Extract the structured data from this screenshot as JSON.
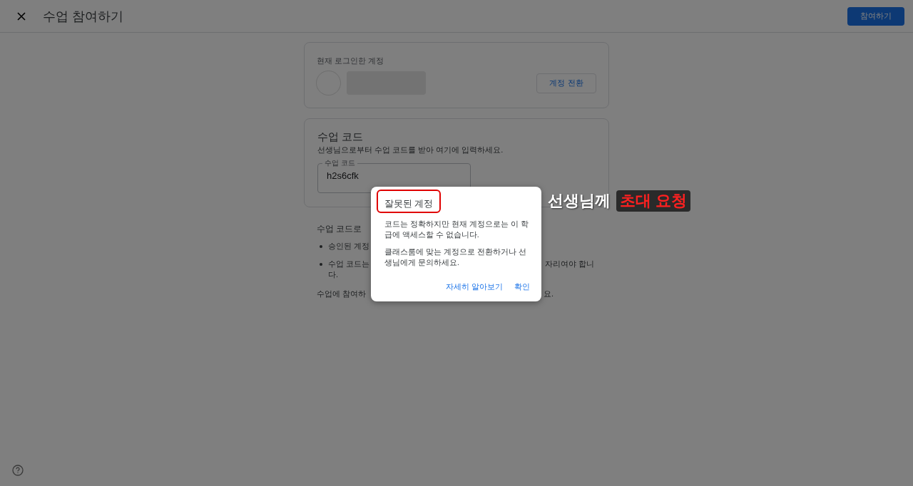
{
  "header": {
    "title": "수업 참여하기",
    "join_button": "참여하기"
  },
  "account_card": {
    "heading": "현재 로그인한 계정",
    "switch_button": "계정 전환"
  },
  "class_code_card": {
    "heading": "수업 코드",
    "description": "선생님으로부터 수업 코드를 받아 여기에 입력하세요.",
    "field": {
      "label": "수업 코드",
      "value": "h2s6cfk"
    }
  },
  "info": {
    "heading": "수업 코드로",
    "bullets": [
      {
        "lines": [
          {
            "left": "승인된 계정"
          }
        ]
      },
      {
        "lines": [
          {
            "left": "수업 코드는",
            "right": "자리여야 합니"
          },
          {
            "left": "다."
          }
        ]
      }
    ],
    "footer": {
      "left": "수업에 참여하",
      "right": "요."
    }
  },
  "dialog": {
    "title": "잘못된 계정",
    "paragraphs": [
      "코드는 정확하지만 현재 계정으로는 이 학급에 액세스할 수 없습니다.",
      "클래스룸에 맞는 계정으로 전환하거나 선생님에게 문의하세요."
    ],
    "actions": [
      "자세히 알아보기",
      "확인"
    ]
  },
  "annotation": {
    "plain": "선생님께",
    "highlight": "초대 요청"
  }
}
